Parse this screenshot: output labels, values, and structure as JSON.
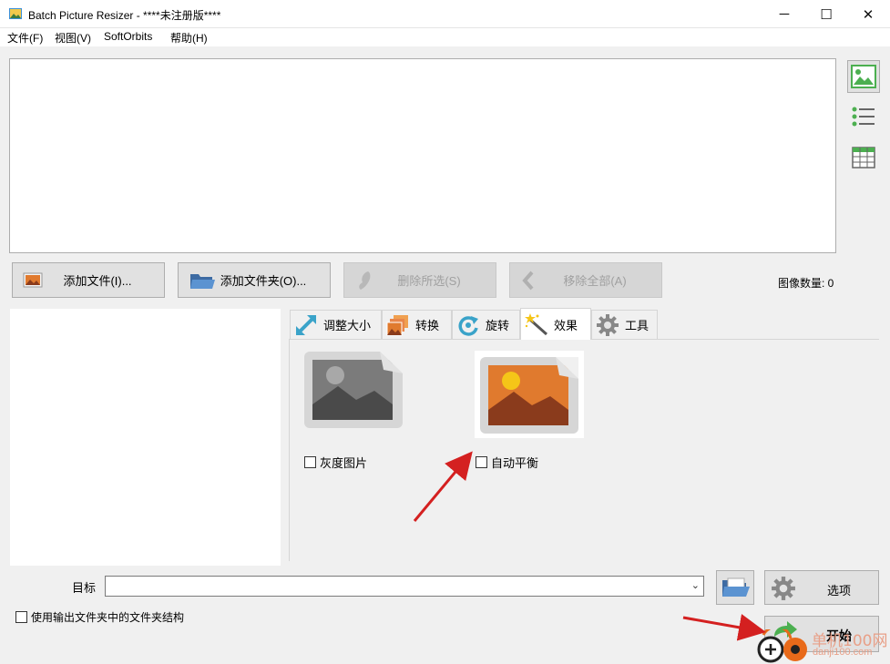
{
  "window": {
    "title": "Batch Picture Resizer - ****未注册版****",
    "minimize_glyph": "─",
    "maximize_glyph": "☐",
    "close_glyph": "✕"
  },
  "menu": {
    "items": [
      "文件(F)",
      "视图(V)",
      "SoftOrbits",
      "帮助(H)"
    ]
  },
  "toolbar": {
    "add_file": "添加文件(I)...",
    "add_folder": "添加文件夹(O)...",
    "remove_selected": "删除所选(S)",
    "remove_all": "移除全部(A)",
    "image_count_label": "图像数量: 0"
  },
  "view_icons": [
    "thumbnail-view-icon",
    "list-view-icon",
    "table-view-icon"
  ],
  "tabs": [
    {
      "label": "调整大小",
      "icon": "resize-icon",
      "active": false
    },
    {
      "label": "转换",
      "icon": "convert-icon",
      "active": false
    },
    {
      "label": "旋转",
      "icon": "rotate-icon",
      "active": false
    },
    {
      "label": "效果",
      "icon": "magic-wand-icon",
      "active": true
    },
    {
      "label": "工具",
      "icon": "gear-icon",
      "active": false
    }
  ],
  "effects": {
    "grayscale_label": "灰度图片",
    "grayscale_checked": false,
    "autobalance_label": "自动平衡",
    "autobalance_checked": false
  },
  "bottom": {
    "target_label": "目标",
    "target_value": "",
    "options_label": "选项",
    "folder_structure_label": "使用输出文件夹中的文件夹结构",
    "folder_structure_checked": false,
    "start_label": "开始"
  },
  "watermark": {
    "line1": "单机100网",
    "line2": "danji100.com"
  },
  "colors": {
    "annotation_arrow": "#d42020",
    "accent_orange": "#e07a2e",
    "accent_green": "#4caf50"
  }
}
